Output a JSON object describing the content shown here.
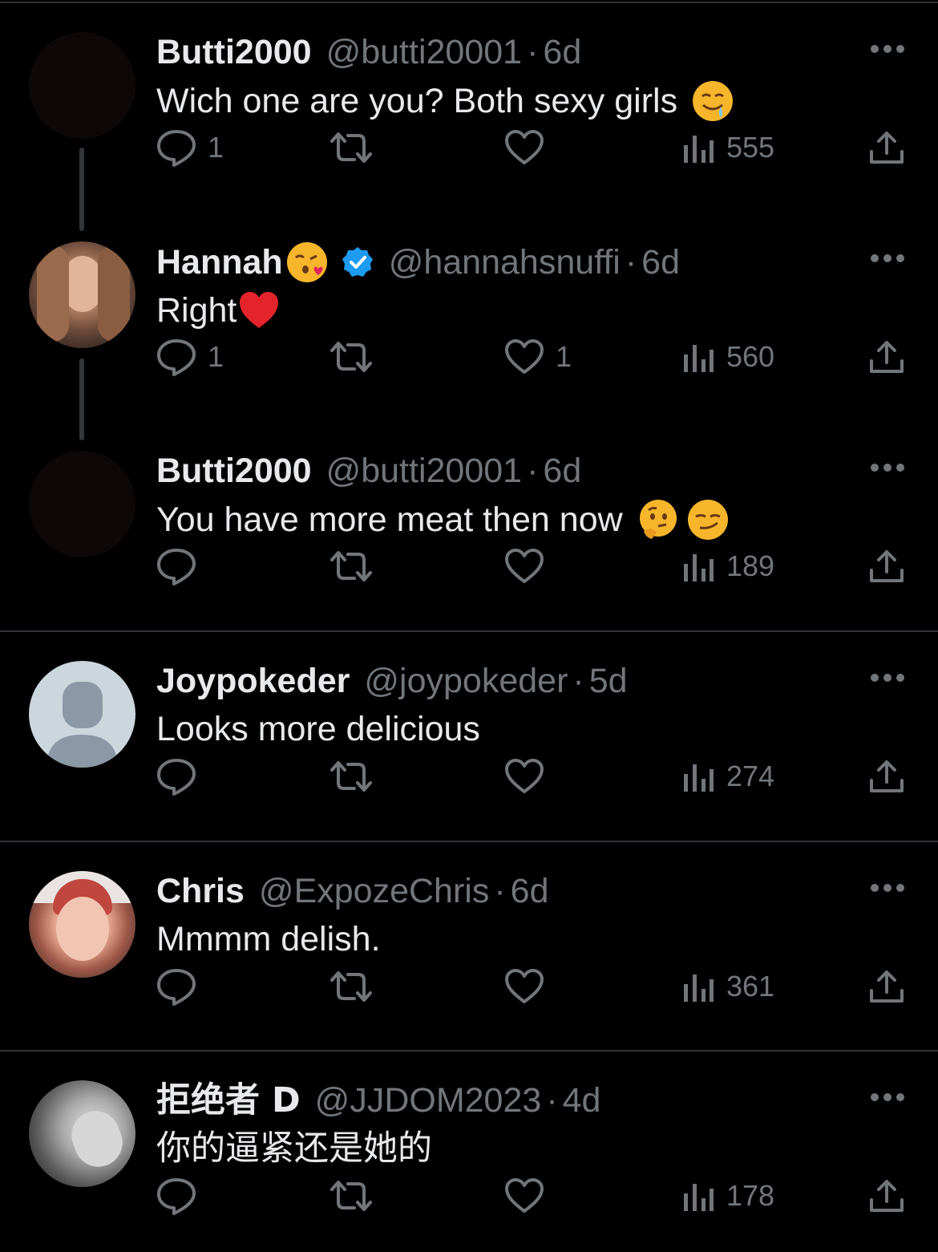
{
  "tweets": [
    {
      "name": "Butti2000",
      "handle": "@butti20001",
      "time": "6d",
      "text": "Wich one are you? Both sexy girls",
      "emojis": [
        "drooling-face-emoji"
      ],
      "replies": "1",
      "retweets": "",
      "likes": "",
      "views": "555",
      "avatar": "dark-placeholder"
    },
    {
      "name": "Hannah",
      "name_emoji": "kissing-face-emoji",
      "verified": true,
      "handle": "@hannahsnuffi",
      "time": "6d",
      "text": "Right",
      "emojis": [
        "red-heart-emoji"
      ],
      "replies": "1",
      "retweets": "",
      "likes": "1",
      "views": "560",
      "avatar": "photo-young-woman"
    },
    {
      "name": "Butti2000",
      "handle": "@butti20001",
      "time": "6d",
      "text": "You have more meat then now",
      "emojis": [
        "thinking-face-emoji",
        "smirking-face-emoji"
      ],
      "replies": "",
      "retweets": "",
      "likes": "",
      "views": "189",
      "avatar": "dark-placeholder"
    },
    {
      "name": "Joypokeder",
      "handle": "@joypokeder",
      "time": "5d",
      "text": "Looks more delicious",
      "emojis": [],
      "replies": "",
      "retweets": "",
      "likes": "",
      "views": "274",
      "avatar": "default-silhouette"
    },
    {
      "name": "Chris",
      "handle": "@ExpozeChris",
      "time": "6d",
      "text": "Mmmm delish.",
      "emojis": [],
      "replies": "",
      "retweets": "",
      "likes": "",
      "views": "361",
      "avatar": "photo-smiling-woman"
    },
    {
      "name": "拒绝者 D",
      "handle": "@JJDOM2023",
      "time": "4d",
      "text": "你的逼紧还是她的",
      "emojis": [],
      "replies": "",
      "retweets": "",
      "likes": "",
      "views": "178",
      "avatar": "photo-grayscale-feet"
    }
  ],
  "separator": "·",
  "colors": {
    "background": "#000000",
    "text": "#e7e9ea",
    "muted": "#71767b",
    "border": "#2f3336",
    "verified": "#1d9bf0"
  },
  "icons": {
    "reply": "reply-icon",
    "retweet": "retweet-icon",
    "like": "heart-icon",
    "views": "views-icon",
    "share": "share-icon",
    "more": "more-icon"
  }
}
